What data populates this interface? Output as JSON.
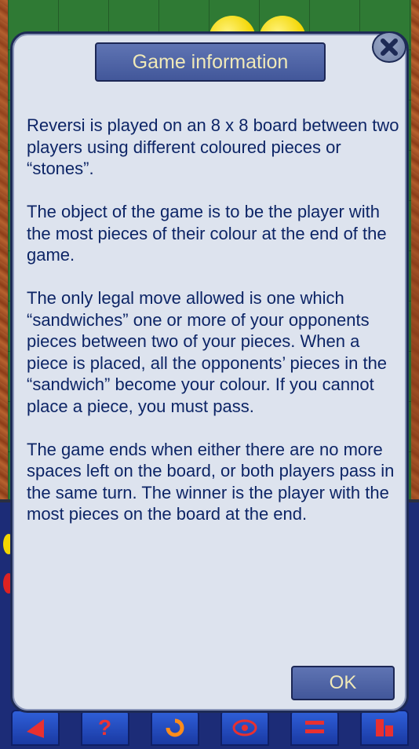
{
  "dialog": {
    "title": "Game information",
    "close_icon": "close-icon",
    "paragraphs": [
      "Reversi is played on an 8 x 8 board between two players using different coloured pieces or “stones”.",
      "The object of the game is to be the player with the most pieces of their colour at the end of the game.",
      "The only legal move allowed is one which “sandwiches” one or more of your opponents pieces between two of your pieces.  When a piece is placed, all the opponents’ pieces in the “sandwich” become your colour.  If you cannot place a piece, you must pass.",
      "The game ends when either there are no more spaces left on the board, or both players pass in the same turn. The winner is the player with the most pieces on the board at the end."
    ],
    "ok_label": "OK"
  },
  "toolbar": {
    "icons": [
      "undo-icon",
      "help-icon",
      "restart-icon",
      "view-icon",
      "menu-icon",
      "settings-icon"
    ]
  },
  "colors": {
    "dialog_bg": "#dde3ee",
    "text": "#0d2566",
    "button_bg": "#4d62a6",
    "button_text": "#f0e9b8",
    "board_green": "#2f7a34",
    "panel_blue": "#1c2c77"
  }
}
